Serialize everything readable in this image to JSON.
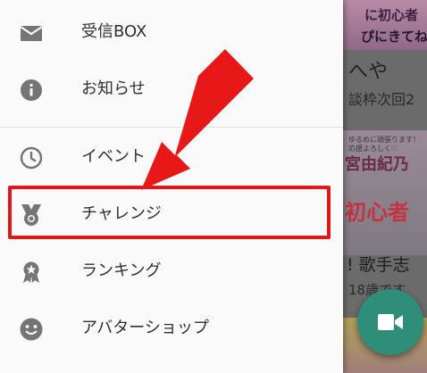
{
  "menu": {
    "items": [
      {
        "label": "受信BOX",
        "icon": "mail-icon"
      },
      {
        "label": "お知らせ",
        "icon": "info-icon"
      },
      {
        "label": "イベント",
        "icon": "clock-icon"
      },
      {
        "label": "チャレンジ",
        "icon": "medal-icon"
      },
      {
        "label": "ランキング",
        "icon": "ribbon-badge-icon"
      },
      {
        "label": "アバターショップ",
        "icon": "smiley-icon"
      }
    ],
    "highlighted_item": "チャレンジ"
  },
  "background": {
    "banner1_line1": "に初心者",
    "banner1_line2": "ぴにきてね",
    "card1_title": "へや",
    "card1_sub": "談枠次回2",
    "banner2_lines": [
      "ゆるめに頑張ります！",
      "応援よろしく♡"
    ],
    "banner2_name": "宮由紀乃",
    "banner2_first": "初心者",
    "card2_title": "! 歌手志",
    "card2_sub": "18歳です"
  },
  "fab": {
    "icon": "video-camera-icon"
  },
  "colors": {
    "drawer_bg": "#fafafa",
    "highlight": "#e01818",
    "arrow": "#e81818",
    "fab": "#2e8e79"
  }
}
